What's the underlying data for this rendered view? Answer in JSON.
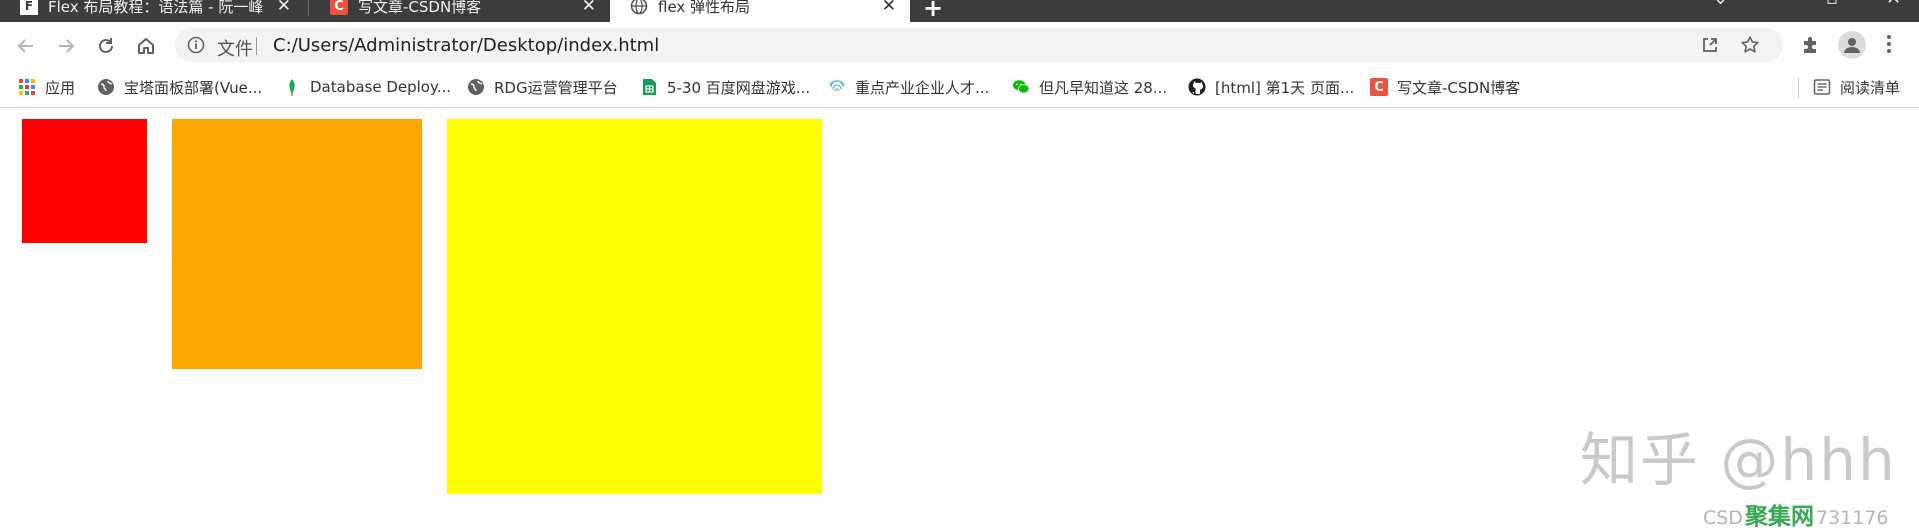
{
  "tabs": [
    {
      "title": "Flex 布局教程：语法篇 - 阮一峰",
      "favicon": "flex-logo-icon",
      "active": false
    },
    {
      "title": "写文章-CSDN博客",
      "favicon": "csdn-icon",
      "active": false
    },
    {
      "title": "flex 弹性布局",
      "favicon": "globe-icon",
      "active": true
    }
  ],
  "tab_close_glyph": "✕",
  "new_tab_glyph": "+",
  "address_bar": {
    "scheme_label": "文件",
    "url": "C:/Users/Administrator/Desktop/index.html"
  },
  "bookmarks": [
    {
      "label": "应用",
      "icon": "apps-grid-icon"
    },
    {
      "label": "宝塔面板部署(Vue...",
      "icon": "globe-icon"
    },
    {
      "label": "Database Deploy...",
      "icon": "mongodb-leaf-icon"
    },
    {
      "label": "RDG运营管理平台",
      "icon": "globe-icon"
    },
    {
      "label": "5-30 百度网盘游戏...",
      "icon": "sheets-icon"
    },
    {
      "label": "重点产业企业人才...",
      "icon": "fingerprint-icon"
    },
    {
      "label": "但凡早知道这 28...",
      "icon": "wechat-icon"
    },
    {
      "label": "[html] 第1天 页面...",
      "icon": "github-icon"
    },
    {
      "label": "写文章-CSDN博客",
      "icon": "csdn-icon"
    }
  ],
  "reading_list": {
    "label": "阅读清单",
    "icon": "reading-list-icon"
  },
  "boxes": [
    {
      "name": "red",
      "color": "#ff0000"
    },
    {
      "name": "orange",
      "color": "#ffa500"
    },
    {
      "name": "yellow",
      "color": "#ffff00"
    }
  ],
  "watermark": {
    "text": "知乎 @hhh"
  },
  "csdn_watermark": {
    "prefix": "CSD",
    "brand": "聚集网",
    "suffix": "731176"
  },
  "colors": {
    "tabstrip": "#3c3c3e",
    "omnibox": "#f1f3f4",
    "csdn": "#e8543d"
  }
}
